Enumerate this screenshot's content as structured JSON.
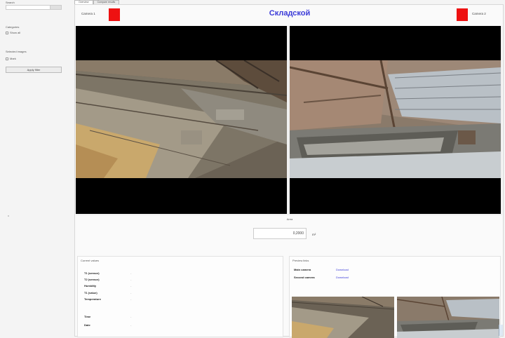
{
  "sidebar": {
    "search_label": "Search",
    "section1_title": "Categories",
    "section1_checkbox": "Show all",
    "section2_title": "Selected images",
    "section2_checkbox": "Mark",
    "action_button": "Apply filter"
  },
  "tabs": [
    "Overview",
    "Compare results"
  ],
  "topbar": {
    "left_label": "Camera 1",
    "right_label": "Camera 2",
    "title": "Складской",
    "status_color": "#ee1111"
  },
  "measure": {
    "label": "Area",
    "value": "0,2000",
    "unit": "m²"
  },
  "left_panel": {
    "title": "Current values",
    "rows": [
      {
        "key": "T1 (sensor)",
        "value": "-"
      },
      {
        "key": "T2 (sensor)",
        "value": "-"
      },
      {
        "key": "Humidity",
        "value": "-"
      },
      {
        "key": "T1 (value)",
        "value": "-"
      },
      {
        "key": "Temperature",
        "value": "-"
      },
      {
        "key": "Time",
        "value": "-"
      },
      {
        "key": "Date",
        "value": "-"
      }
    ]
  },
  "right_panel": {
    "title": "Preview links",
    "rows": [
      {
        "key": "Main camera",
        "link": "Download"
      },
      {
        "key": "Second camera",
        "link": "Download"
      }
    ]
  }
}
